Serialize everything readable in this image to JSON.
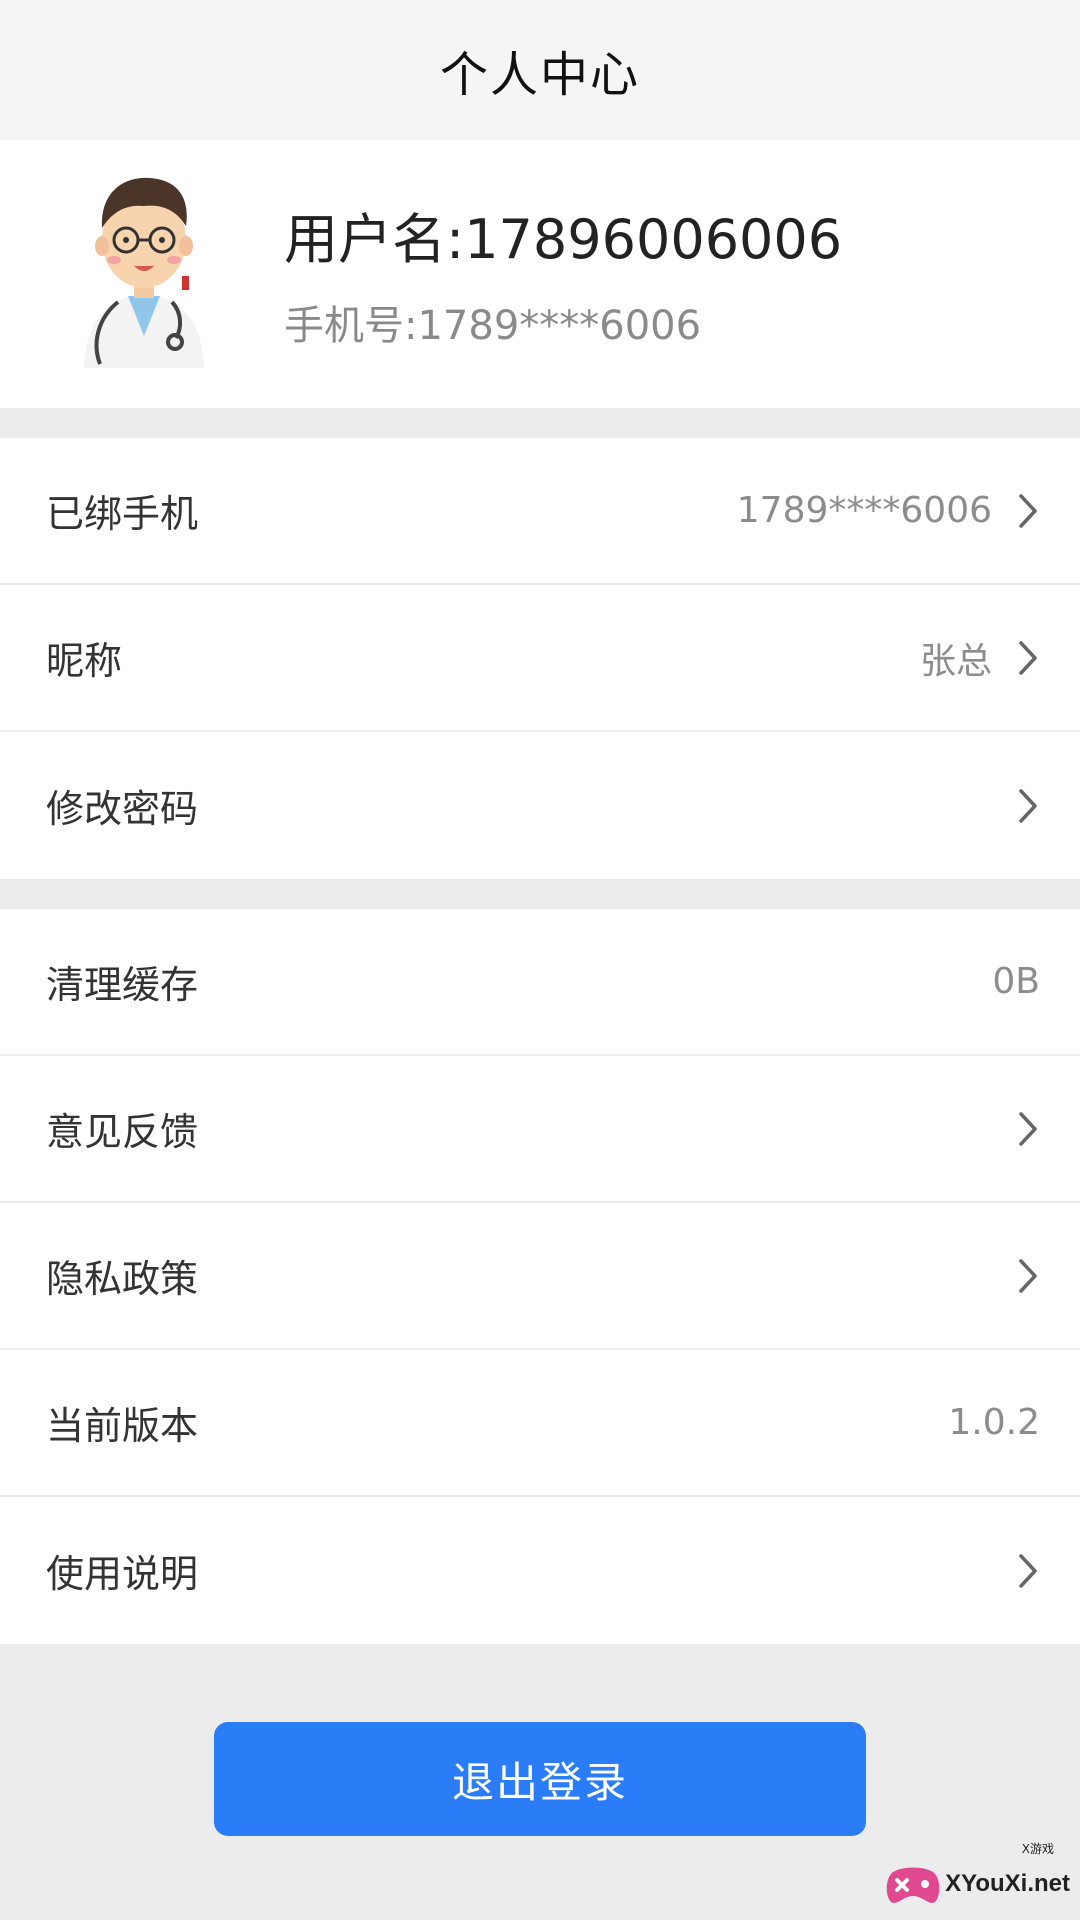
{
  "header": {
    "title": "个人中心"
  },
  "profile": {
    "username": "用户名:17896006006",
    "phone": "手机号:1789****6006"
  },
  "group1": [
    {
      "label": "已绑手机",
      "value": "1789****6006",
      "chevron": true
    },
    {
      "label": "昵称",
      "value": "张总",
      "chevron": true
    },
    {
      "label": "修改密码",
      "value": "",
      "chevron": true
    }
  ],
  "group2": [
    {
      "label": "清理缓存",
      "value": "0B",
      "chevron": false
    },
    {
      "label": "意见反馈",
      "value": "",
      "chevron": true
    },
    {
      "label": "隐私政策",
      "value": "",
      "chevron": true
    },
    {
      "label": "当前版本",
      "value": "1.0.2",
      "chevron": false
    },
    {
      "label": "使用说明",
      "value": "",
      "chevron": true
    }
  ],
  "logout": {
    "label": "退出登录"
  },
  "watermark": {
    "text": "XYouXi.net",
    "small": "X游戏"
  },
  "colors": {
    "accent": "#2b7cf7",
    "background": "#ececec"
  },
  "icons": {
    "avatar": "doctor-avatar-icon",
    "chevron": "chevron-right-icon"
  }
}
